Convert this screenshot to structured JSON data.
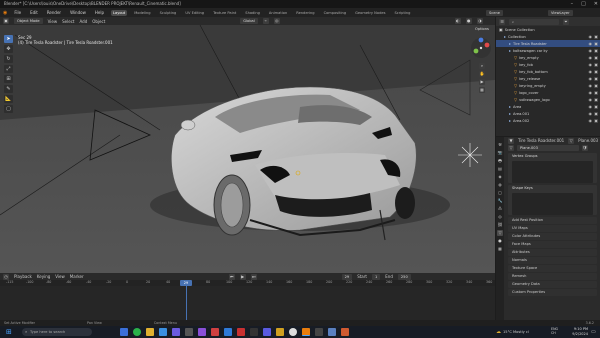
{
  "titlebar": {
    "title": "Blender* [C:\\Users\\louis\\OneDrive\\Desktop\\BLENDER PROJEKT\\Renault_Cinematic.blend]"
  },
  "menu": {
    "items": [
      "File",
      "Edit",
      "Render",
      "Window",
      "Help"
    ],
    "workspaces": [
      "Layout",
      "Modeling",
      "Sculpting",
      "UV Editing",
      "Texture Paint",
      "Shading",
      "Animation",
      "Rendering",
      "Compositing",
      "Geometry Nodes",
      "Scripting"
    ],
    "active_workspace": "Layout",
    "scene_label": "Scene",
    "view_layer_label": "ViewLayer"
  },
  "viewport_header": {
    "mode": "Object Mode",
    "menus": [
      "View",
      "Select",
      "Add",
      "Object"
    ],
    "transform": "Global",
    "options": "Options"
  },
  "viewport_info": {
    "line1": "Sec 29",
    "line2": "(4) Tire Tesla Roadster | Tire Tesla Roadster.001"
  },
  "outliner": {
    "root": "Scene Collection",
    "rows": [
      {
        "label": "Collection",
        "indent": 1
      },
      {
        "label": "Tire Tesla Roadster",
        "indent": 2
      },
      {
        "label": "koltsewagen car ky",
        "indent": 2
      },
      {
        "label": "key_empty",
        "indent": 3
      },
      {
        "label": "key_fob",
        "indent": 3
      },
      {
        "label": "key_fob_bottom",
        "indent": 3
      },
      {
        "label": "key_release",
        "indent": 3
      },
      {
        "label": "keyring_empty",
        "indent": 3
      },
      {
        "label": "logo_cover",
        "indent": 3
      },
      {
        "label": "volkswagen_logo",
        "indent": 3
      },
      {
        "label": "Area",
        "indent": 2
      },
      {
        "label": "Area.001",
        "indent": 2
      },
      {
        "label": "Area.002",
        "indent": 2
      }
    ],
    "selected_index": 1
  },
  "properties": {
    "object_name": "Tire Tesla Roadster.001",
    "mesh_name": "Plane.003",
    "data_name": "Plane.003",
    "panels": [
      "Vertex Groups",
      "Shape Keys"
    ],
    "sections": [
      "Add Rest Position",
      "UV Maps",
      "Color Attributes",
      "Face Maps",
      "Attributes",
      "Normals",
      "Texture Space",
      "Remesh",
      "Geometry Data",
      "Custom Properties"
    ]
  },
  "timeline": {
    "menus": [
      "Playback",
      "Keying",
      "View",
      "Marker"
    ],
    "start_label": "Start",
    "start": "1",
    "end_label": "End",
    "end": "250",
    "current_frame": "29",
    "ticks": [
      "-115",
      "-100",
      "-80",
      "-60",
      "-40",
      "-20",
      "0",
      "20",
      "40",
      "60",
      "80",
      "100",
      "120",
      "140",
      "160",
      "180",
      "200",
      "220",
      "240",
      "260",
      "280",
      "300",
      "320",
      "340",
      "360"
    ]
  },
  "statusbar": {
    "left": "Set Active Modifier",
    "mid1": "Pan View",
    "mid2": "Context Menu",
    "version": "3.6.2"
  },
  "taskbar": {
    "search_placeholder": "Type here to search",
    "weather": "15°C  Mostly cl",
    "lang": "ENG",
    "region": "CH",
    "time": "9:10 PM",
    "date": "9/2/2024"
  },
  "colors": {
    "accent": "#4772b3",
    "viewport_bg": "#3b3b3b",
    "panel_bg": "#2b2b2b"
  },
  "icons": [
    "cursor-icon",
    "move-icon",
    "rotate-icon",
    "scale-icon",
    "transform-icon",
    "annotate-icon",
    "measure-icon",
    "add-cube-icon",
    "eye-icon",
    "camera-icon",
    "wrench-icon",
    "mesh-data-icon",
    "windows-start-icon",
    "blender-icon"
  ]
}
